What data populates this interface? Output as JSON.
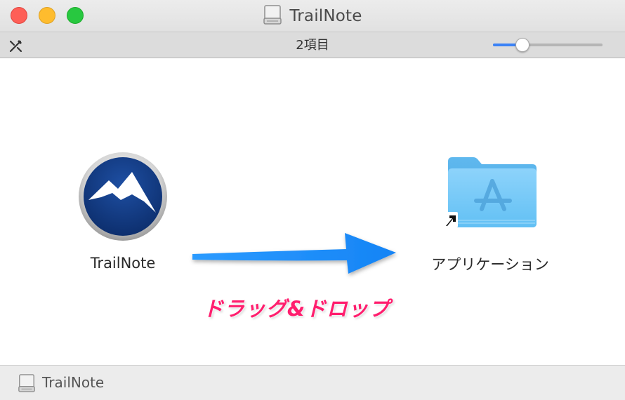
{
  "window": {
    "title": "TrailNote",
    "title_icon": "disk-icon"
  },
  "statusbar": {
    "tools_icon": "pen-tools-icon",
    "item_count": "2項目",
    "zoom_slider_level": 0.27
  },
  "content": {
    "app": {
      "label": "TrailNote",
      "icon": "trailnote-mountain-icon"
    },
    "instruction": "ドラッグ&ドロップ",
    "folder": {
      "label": "アプリケーション",
      "icon": "applications-folder-icon",
      "alias_badge": "alias-arrow-icon"
    }
  },
  "pathbar": {
    "label": "TrailNote",
    "icon": "disk-icon"
  },
  "colors": {
    "accent": "#3b82f6",
    "close": "#fe5f57",
    "minimize": "#febc2e",
    "zoom": "#28c840",
    "instruction_text": "#ff1e6e",
    "arrow": "#1e90ff",
    "folder": "#6cc4f5"
  }
}
